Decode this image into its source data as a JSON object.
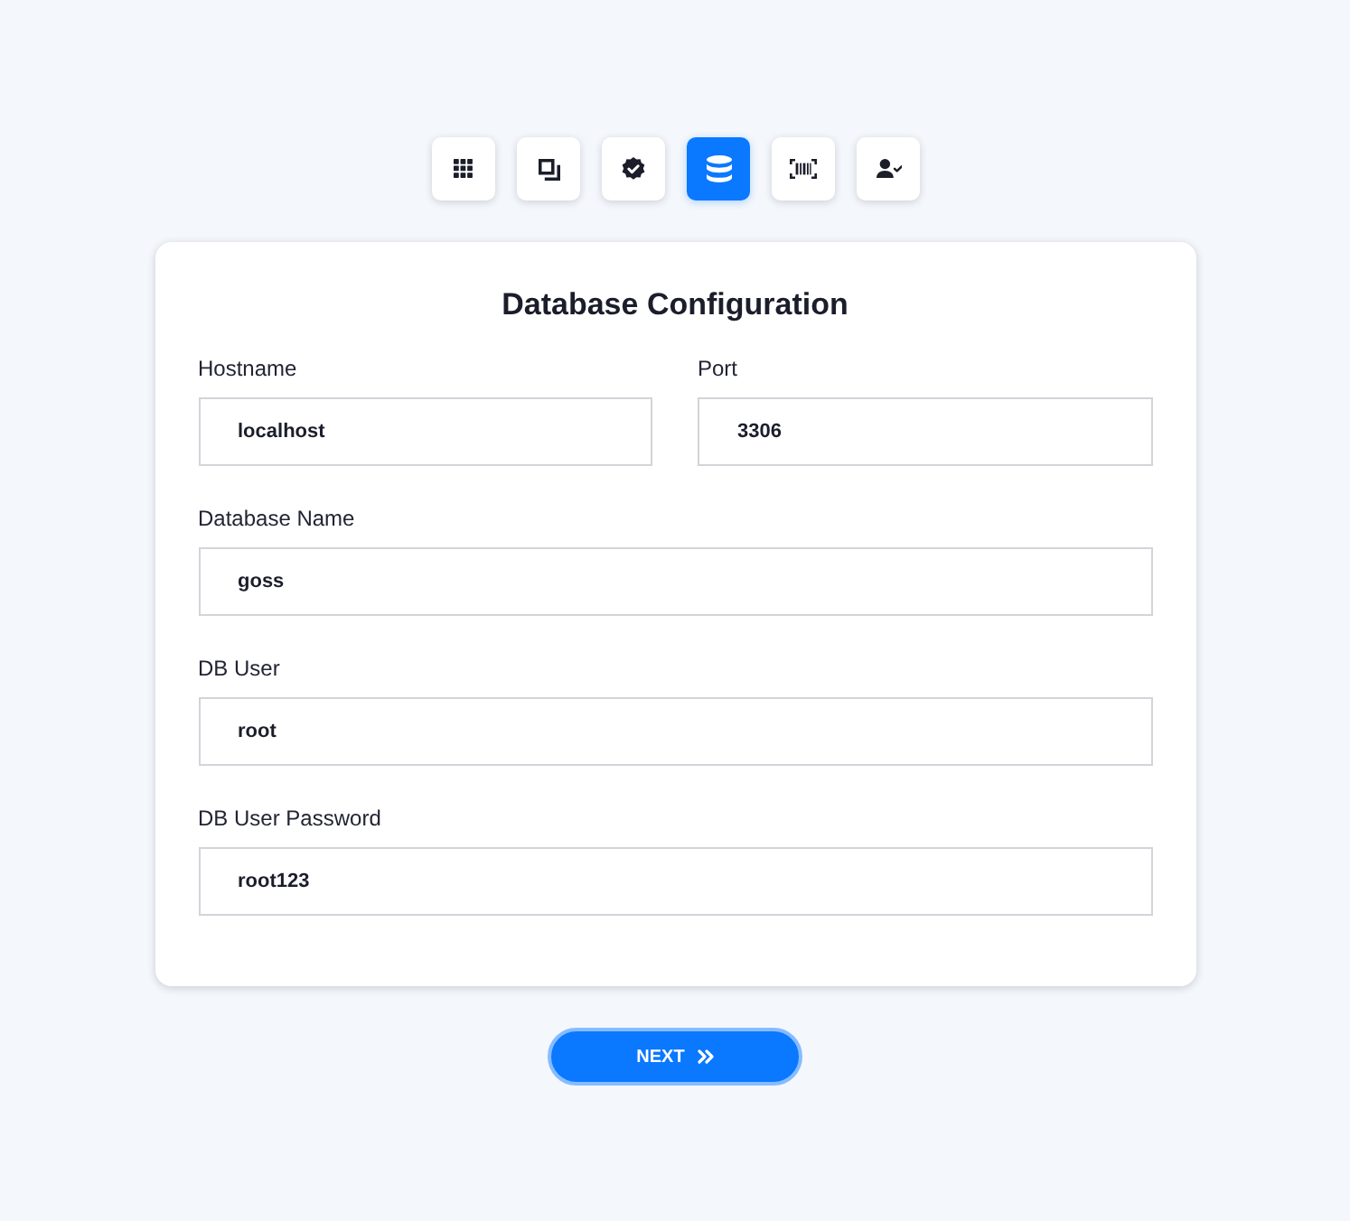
{
  "steps": [
    {
      "kind": "grid",
      "selected": false
    },
    {
      "kind": "squares",
      "selected": false
    },
    {
      "kind": "badge",
      "selected": false
    },
    {
      "kind": "database",
      "selected": true
    },
    {
      "kind": "barcode",
      "selected": false
    },
    {
      "kind": "user",
      "selected": false
    }
  ],
  "form": {
    "title": "Database Configuration",
    "rows": [
      {
        "fields": [
          {
            "label": "Hostname",
            "value": "localhost"
          },
          {
            "label": "Port",
            "value": "3306"
          }
        ]
      },
      {
        "fields": [
          {
            "label": "Database Name",
            "value": "goss"
          }
        ]
      },
      {
        "fields": [
          {
            "label": "DB User",
            "value": "root"
          }
        ]
      },
      {
        "fields": [
          {
            "label": "DB User Password",
            "value": "root123"
          }
        ]
      }
    ]
  },
  "next_button": {
    "label": "NEXT"
  }
}
